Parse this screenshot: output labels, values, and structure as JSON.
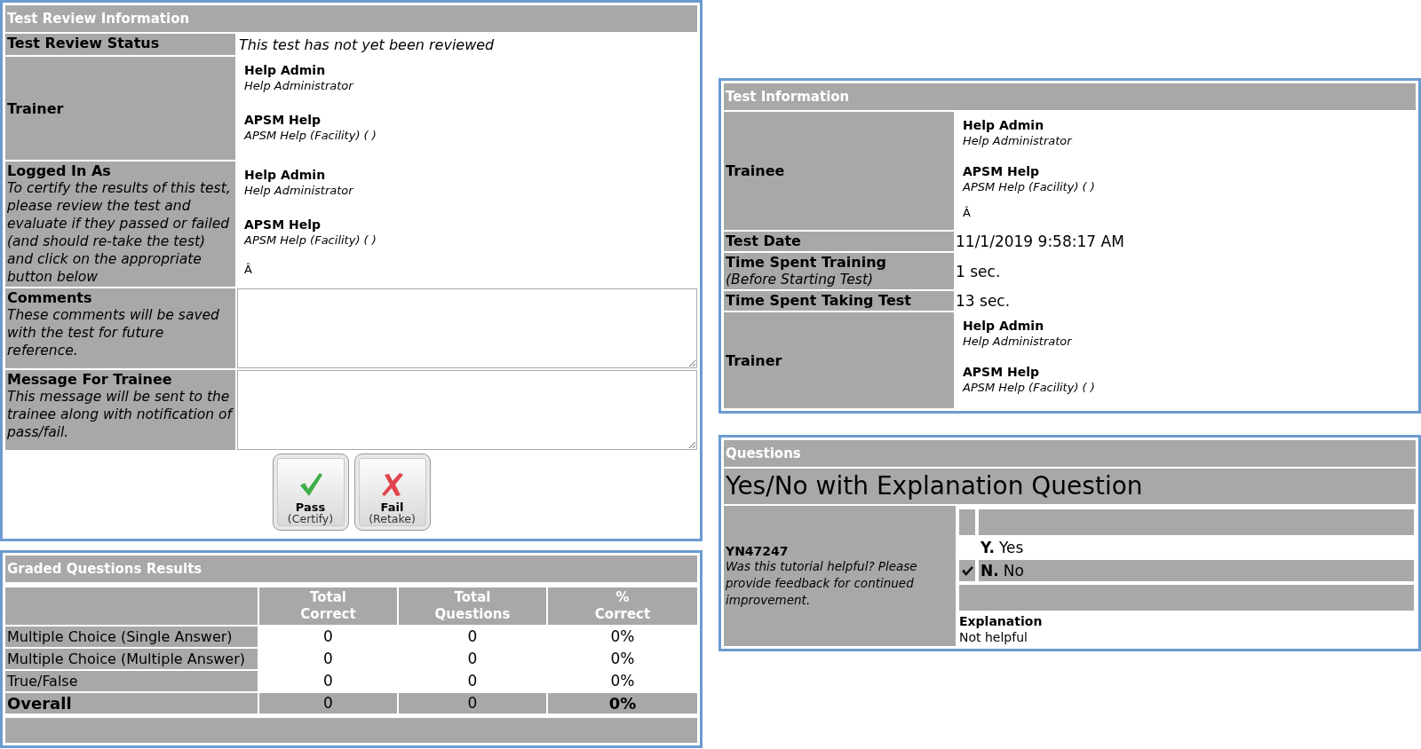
{
  "review_panel": {
    "title": "Test Review Information",
    "rows": [
      {
        "kind": "text",
        "label": "Test Review Status",
        "value": "This test has not yet been reviewed"
      },
      {
        "kind": "people",
        "label": "Trainer",
        "people": [
          {
            "name": "Help Admin",
            "role": "Help Administrator"
          },
          {
            "name": "APSM Help",
            "role": "APSM Help (Facility) ( )"
          }
        ]
      },
      {
        "kind": "people",
        "label": "Logged In As",
        "note": "To certify the results of this test, please review the test and evaluate if they passed or failed (and should re-take the test) and click on the appropriate button below",
        "people": [
          {
            "name": "Help Admin",
            "role": "Help Administrator"
          },
          {
            "name": "APSM Help",
            "role": "APSM Help (Facility) ( )"
          }
        ],
        "extra": "Â"
      },
      {
        "kind": "textarea",
        "label": "Comments",
        "note": "These comments will be saved with the test for future reference."
      },
      {
        "kind": "textarea",
        "label": "Message For Trainee",
        "note": "This message will be sent to the trainee along with notification of pass/fail."
      }
    ],
    "buttons": [
      {
        "kind": "pass",
        "label": "Pass",
        "sublabel": "(Certify)"
      },
      {
        "kind": "fail",
        "label": "Fail",
        "sublabel": "(Retake)"
      }
    ]
  },
  "graded_results": {
    "title": "Graded Questions Results",
    "columns": [
      "Total\nCorrect",
      "Total\nQuestions",
      "%\nCorrect"
    ],
    "rows": [
      {
        "kind": "item",
        "label": "Multiple Choice (Single Answer)",
        "cells": [
          "0",
          "0",
          "0%"
        ]
      },
      {
        "kind": "item",
        "label": "Multiple Choice (Multiple Answer)",
        "cells": [
          "0",
          "0",
          "0%"
        ]
      },
      {
        "kind": "item",
        "label": "True/False",
        "cells": [
          "0",
          "0",
          "0%"
        ]
      },
      {
        "kind": "total",
        "label": "Overall",
        "cells": [
          "0",
          "0",
          "0%"
        ]
      }
    ]
  },
  "test_information": {
    "title": "Test Information",
    "rows": [
      {
        "kind": "people",
        "label": "Trainee",
        "people": [
          {
            "name": "Help Admin",
            "role": "Help Administrator"
          },
          {
            "name": "APSM Help",
            "role": "APSM Help (Facility) ( )"
          }
        ],
        "extra": "Â"
      },
      {
        "kind": "text",
        "label": "Test Date",
        "value": "11/1/2019 9:58:17 AM"
      },
      {
        "kind": "text",
        "label": "Time Spent Training",
        "note": "(Before Starting Test)",
        "value": "1 sec."
      },
      {
        "kind": "text",
        "label": "Time Spent Taking Test",
        "value": "13 sec."
      },
      {
        "kind": "people",
        "label": "Trainer",
        "people": [
          {
            "name": "Help Admin",
            "role": "Help Administrator"
          },
          {
            "name": "APSM Help",
            "role": "APSM Help (Facility) ( )"
          }
        ]
      }
    ]
  },
  "questions": {
    "title": "Questions",
    "heading": "Yes/No with Explanation Question",
    "id": "YN47247",
    "text": "Was this tutorial helpful? Please provide feedback for continued improvement.",
    "choices": [
      {
        "label": "**Y.** Yes",
        "selected": false
      },
      {
        "label": "**N.** No",
        "selected": true
      }
    ],
    "explanation_label": "Explanation",
    "explanation": "Not helpful"
  }
}
